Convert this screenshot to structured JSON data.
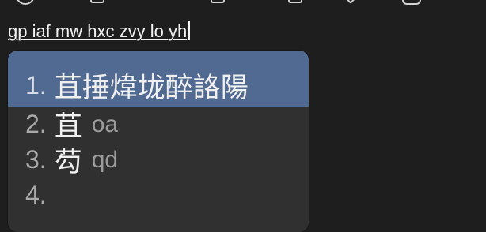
{
  "editor": {
    "text": "gp iaf mw hxc zvy lo yh"
  },
  "candidates": [
    {
      "index": "1.",
      "text": "苴捶煒垅醉詻陽",
      "roman": ""
    },
    {
      "index": "2.",
      "text": "苴",
      "roman": "oa"
    },
    {
      "index": "3.",
      "text": "芶",
      "roman": "qd"
    },
    {
      "index": "4.",
      "text": "",
      "roman": ""
    }
  ],
  "colors": {
    "background": "#1e1e1e",
    "candidate_panel": "#303030",
    "selected_candidate": "#516a91"
  },
  "icons": [
    "top-bar-icon",
    "top-bar-icon",
    "top-bar-icon",
    "top-bar-icon",
    "top-bar-icon",
    "top-bar-icon"
  ]
}
